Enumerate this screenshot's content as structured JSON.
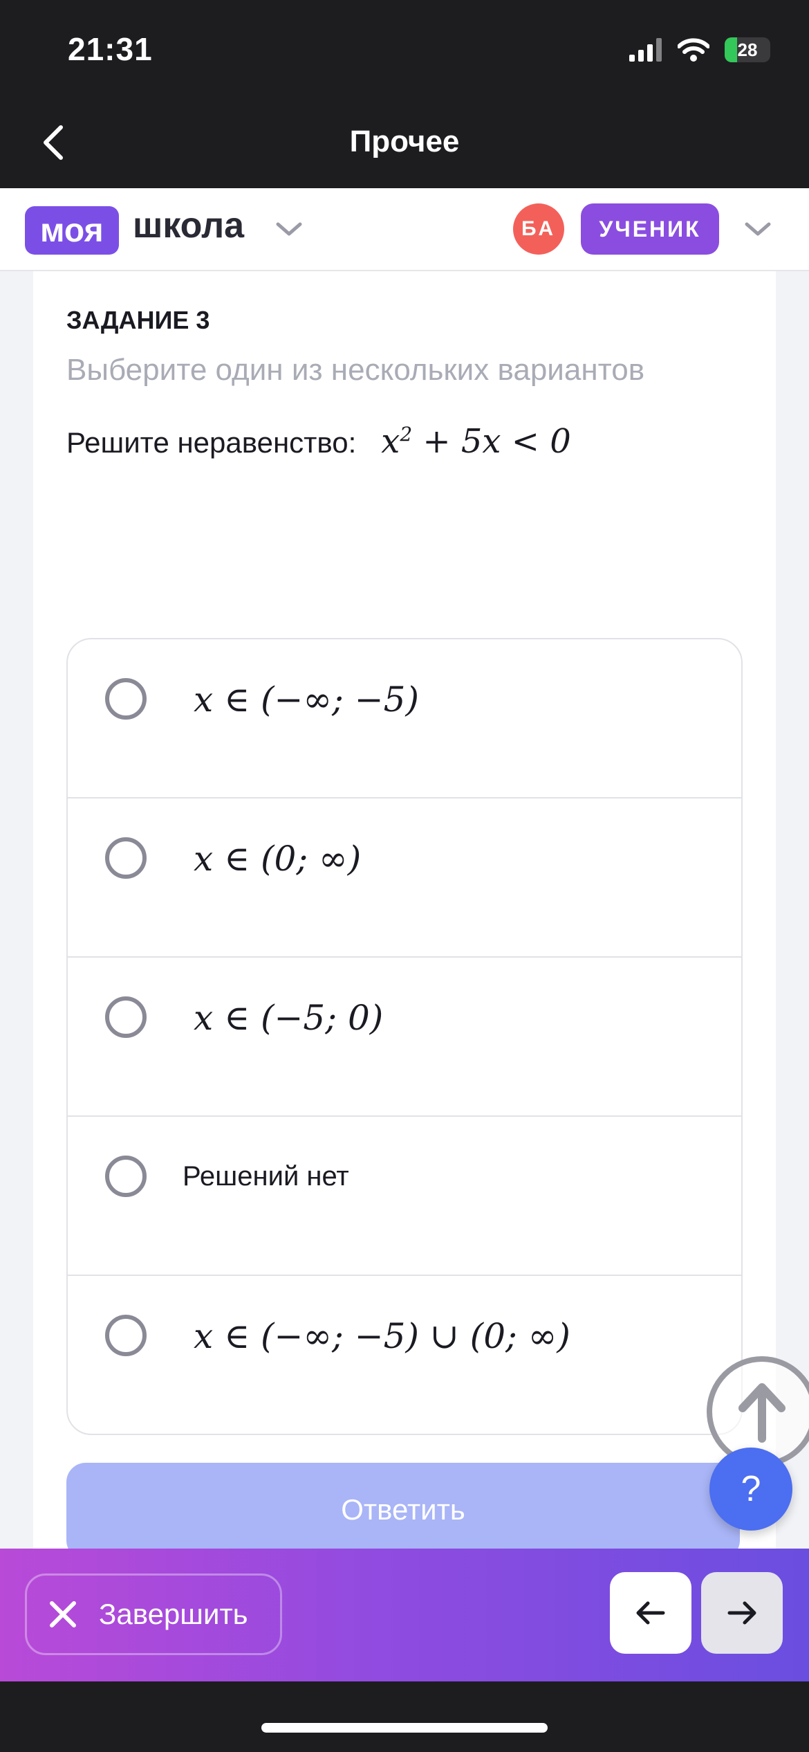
{
  "status_bar": {
    "time": "21:31",
    "battery": "28",
    "battery_level": 0.28
  },
  "nav": {
    "title": "Прочее"
  },
  "header": {
    "logo_part1": "моя",
    "logo_part2": "школа",
    "avatar_initials": "БА",
    "role": "УЧЕНИК"
  },
  "task": {
    "label": "ЗАДАНИЕ 3",
    "hint": "Выберите один из нескольких вариантов",
    "question_text": "Решите неравенство:",
    "inequality_base": "x",
    "inequality_exp": "2",
    "inequality_rest": " + 5x < 0"
  },
  "options": [
    {
      "text": "x ∈ (−∞; −5)"
    },
    {
      "text": "x ∈ (0; ∞)"
    },
    {
      "text": "x ∈ (−5; 0)"
    },
    {
      "text": "Решений нет"
    },
    {
      "text": "x ∈ (−∞; −5) ∪ (0; ∞)"
    }
  ],
  "submit_label": "Ответить",
  "help_label": "?",
  "bottom": {
    "finish_label": "Завершить"
  },
  "colors": {
    "brand_purple": "#7b4fe6",
    "avatar_red": "#f3605a",
    "submit_disabled": "#a9b5f7",
    "help_blue": "#4c6ef0"
  }
}
